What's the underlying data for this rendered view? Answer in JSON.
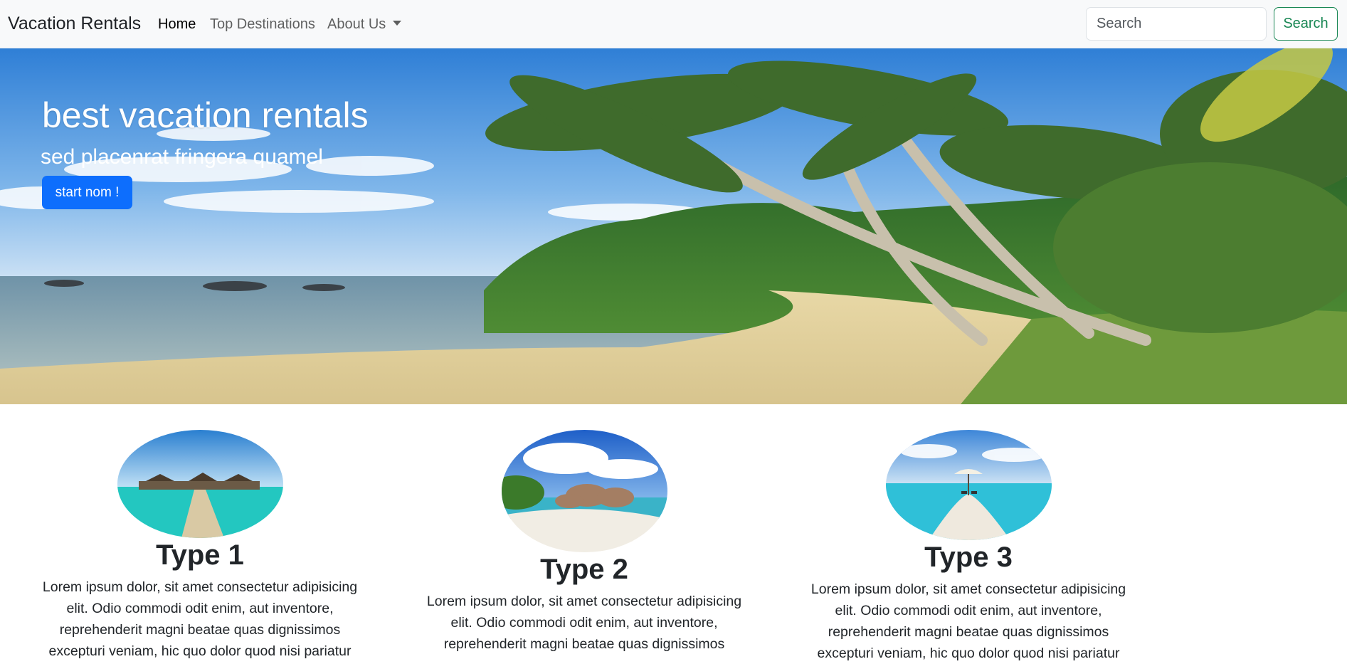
{
  "navbar": {
    "brand": "Vacation Rentals",
    "links": [
      {
        "label": "Home",
        "active": true
      },
      {
        "label": "Top Destinations",
        "active": false
      },
      {
        "label": "About Us",
        "active": false
      }
    ],
    "search": {
      "placeholder": "Search",
      "button_label": "Search"
    }
  },
  "hero": {
    "title": "best vacation rentals",
    "subtitle": "sed placenrat fringera quamel",
    "button_label": "start nom !"
  },
  "cards": [
    {
      "title": "Type 1",
      "text": "Lorem ipsum dolor, sit amet consectetur adipisicing elit. Odio commodi odit enim, aut inventore, reprehenderit magni beatae quas dignissimos excepturi veniam, hic quo dolor quod nisi pariatur"
    },
    {
      "title": "Type 2",
      "text": "Lorem ipsum dolor, sit amet consectetur adipisicing elit. Odio commodi odit enim, aut inventore, reprehenderit magni beatae quas dignissimos"
    },
    {
      "title": "Type 3",
      "text": "Lorem ipsum dolor, sit amet consectetur adipisicing elit. Odio commodi odit enim, aut inventore, reprehenderit magni beatae quas dignissimos excepturi veniam, hic quo dolor quod nisi pariatur"
    }
  ],
  "colors": {
    "primary": "#0d6efd",
    "success": "#198754",
    "navbar_bg": "#f8f9fa"
  }
}
